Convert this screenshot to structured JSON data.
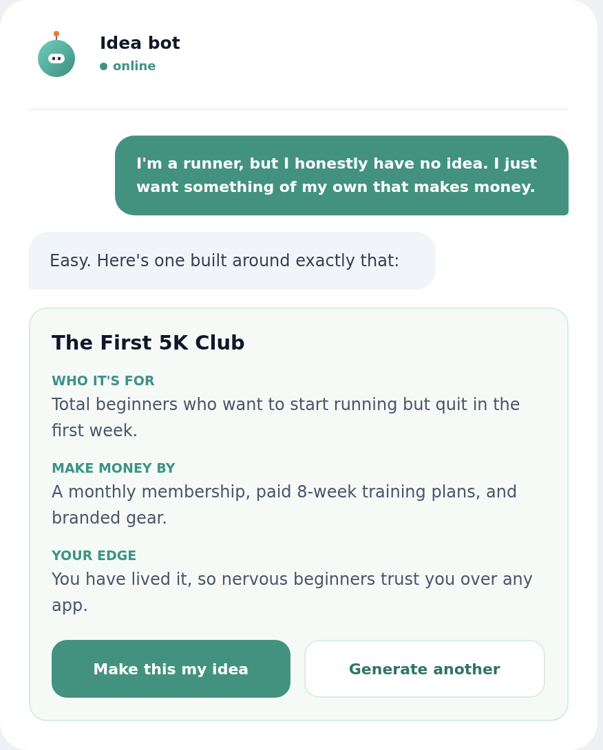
{
  "header": {
    "title": "Idea bot",
    "status": {
      "label": "online",
      "online": true
    }
  },
  "messages": [
    {
      "kind": "user",
      "text": "I'm a runner, but I honestly have no idea. I just want something of my own that makes money."
    },
    {
      "kind": "bot",
      "text": "Easy. Here's one built around exactly that:"
    }
  ],
  "idea_card": {
    "title": "The First 5K Club",
    "sections": [
      {
        "label": "WHO IT'S FOR",
        "text": "Total beginners who want to start running but quit in the first week."
      },
      {
        "label": "MAKE MONEY BY",
        "text": "A monthly membership, paid 8-week training plans, and branded gear."
      },
      {
        "label": "YOUR EDGE",
        "text": "You have lived it, so nervous beginners trust you over any app."
      }
    ],
    "buttons": [
      {
        "kind": "primary",
        "label": "Make this my idea"
      },
      {
        "kind": "secondary",
        "label": "Generate another"
      }
    ]
  }
}
